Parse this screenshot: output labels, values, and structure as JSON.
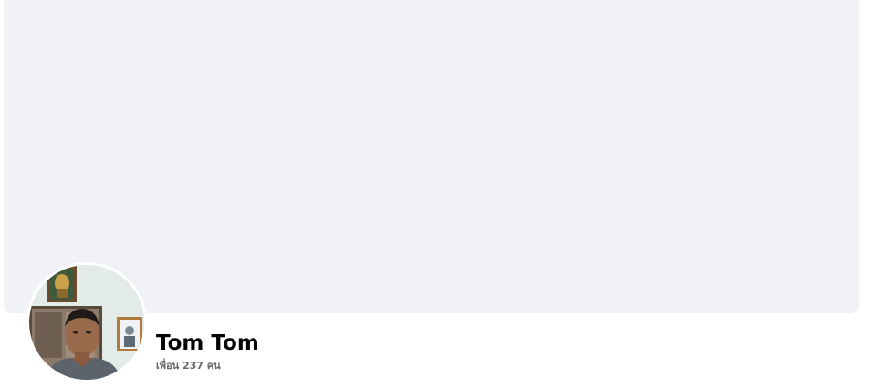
{
  "profile": {
    "name": "Tom Tom",
    "friends_text": "เพื่อน 237 คน"
  },
  "colors": {
    "cover_background": "#f0f2f5",
    "name_text": "#050505",
    "secondary_text": "#65676b"
  }
}
